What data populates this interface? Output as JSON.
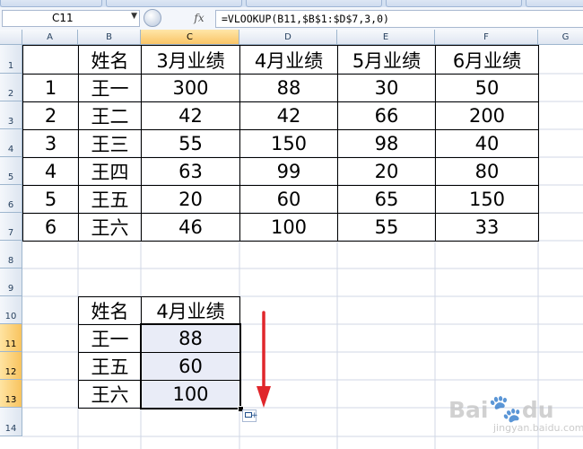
{
  "formula_bar": {
    "name_box": "C11",
    "fx_label": "fx",
    "formula": "=VLOOKUP(B11,$B$1:$D$7,3,0)"
  },
  "columns": [
    "A",
    "B",
    "C",
    "D",
    "E",
    "F",
    "G"
  ],
  "rows": [
    "1",
    "2",
    "3",
    "4",
    "5",
    "6",
    "7",
    "8",
    "9",
    "10",
    "11",
    "12",
    "13",
    "14"
  ],
  "selected_column": "C",
  "selected_rows": [
    "11",
    "12",
    "13"
  ],
  "main_table": {
    "header": [
      "",
      "姓名",
      "3月业绩",
      "4月业绩",
      "5月业绩",
      "6月业绩"
    ],
    "rows": [
      [
        "1",
        "王一",
        "300",
        "88",
        "30",
        "50"
      ],
      [
        "2",
        "王二",
        "42",
        "42",
        "66",
        "200"
      ],
      [
        "3",
        "王三",
        "55",
        "150",
        "98",
        "40"
      ],
      [
        "4",
        "王四",
        "63",
        "99",
        "20",
        "80"
      ],
      [
        "5",
        "王五",
        "20",
        "60",
        "65",
        "150"
      ],
      [
        "6",
        "王六",
        "46",
        "100",
        "55",
        "33"
      ]
    ]
  },
  "lookup_table": {
    "header": [
      "姓名",
      "4月业绩"
    ],
    "rows": [
      [
        "王一",
        "88"
      ],
      [
        "王五",
        "60"
      ],
      [
        "王六",
        "100"
      ]
    ]
  },
  "annotation": {
    "arrow_color": "#e0262b",
    "direction": "down"
  },
  "colors": {
    "selection_header": "#f9c567",
    "selected_cells": "#e9ecf7",
    "grid_header": "#dfe6f1"
  },
  "watermark": {
    "brand": "Bai du",
    "sub": "jingyan.baidu.com"
  }
}
